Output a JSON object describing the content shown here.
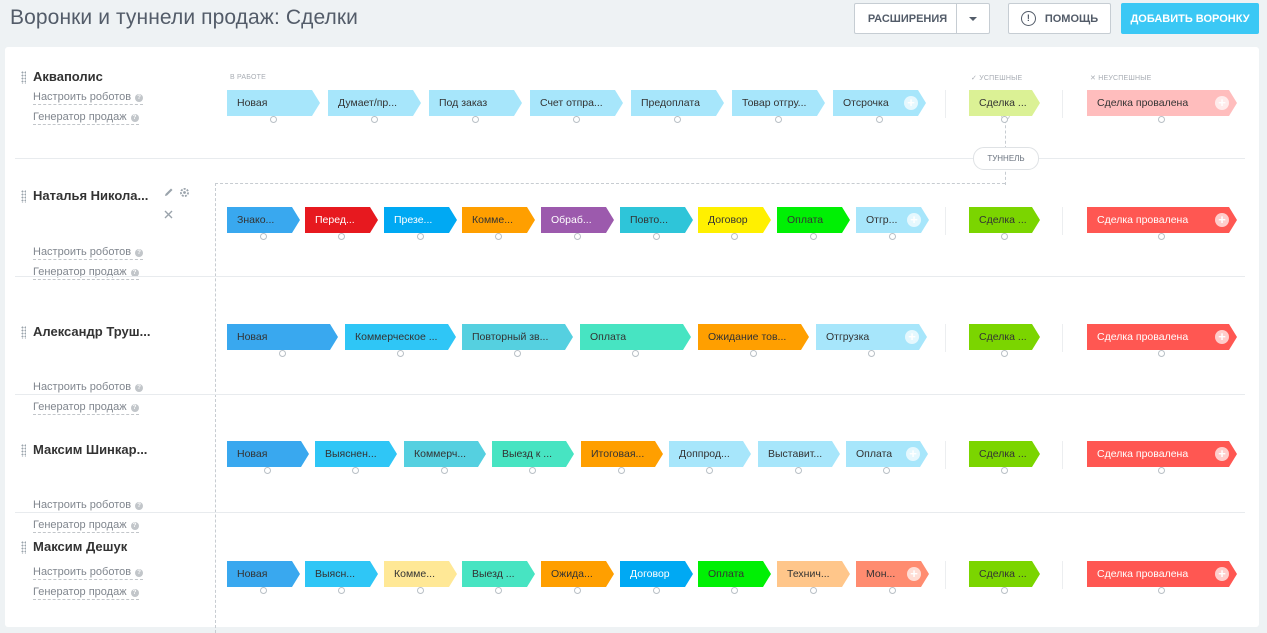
{
  "header": {
    "title": "Воронки и туннели продаж: Сделки",
    "extensions_label": "РАСШИРЕНИЯ",
    "help_label": "ПОМОЩЬ",
    "add_label": "ДОБАВИТЬ ВОРОНКУ"
  },
  "sections": {
    "in_work": "В РАБОТЕ",
    "success": "УСПЕШНЫЕ",
    "fail": "НЕУСПЕШНЫЕ"
  },
  "tunnel_label": "ТУННЕЛЬ",
  "funnels": [
    {
      "name": "Акваполис",
      "robots": "Настроить роботов",
      "generator": "Генератор продаж",
      "stages": [
        {
          "label": "Новая",
          "color": "#a7e6fb"
        },
        {
          "label": "Думает/пр...",
          "color": "#a7e6fb"
        },
        {
          "label": "Под заказ",
          "color": "#a7e6fb"
        },
        {
          "label": "Счет отпра...",
          "color": "#a7e6fb"
        },
        {
          "label": "Предоплата",
          "color": "#a7e6fb"
        },
        {
          "label": "Товар отгру...",
          "color": "#a7e6fb"
        },
        {
          "label": "Отсрочка",
          "color": "#a7e6fb"
        }
      ],
      "success": {
        "label": "Сделка ...",
        "color": "#dbf195"
      },
      "fail": {
        "label": "Сделка провалена",
        "color": "#ffbdbd"
      }
    },
    {
      "name": "Наталья Никола...",
      "robots": "Настроить роботов",
      "generator": "Генератор продаж",
      "stages": [
        {
          "label": "Знако...",
          "color": "#39a8ef"
        },
        {
          "label": "Перед...",
          "color": "#e7191f"
        },
        {
          "label": "Презе...",
          "color": "#00a9f3"
        },
        {
          "label": "Комме...",
          "color": "#ff9f00"
        },
        {
          "label": "Обраб...",
          "color": "#9c5aad"
        },
        {
          "label": "Повто...",
          "color": "#2ec5d9"
        },
        {
          "label": "Договор",
          "color": "#fff000"
        },
        {
          "label": "Оплата",
          "color": "#00f004"
        },
        {
          "label": "Отгр...",
          "color": "#a7e6fb"
        }
      ],
      "success": {
        "label": "Сделка ...",
        "color": "#7bd500"
      },
      "fail": {
        "label": "Сделка провалена",
        "color": "#ff5752"
      }
    },
    {
      "name": "Александр Труш...",
      "robots": "Настроить роботов",
      "generator": "Генератор продаж",
      "stages": [
        {
          "label": "Новая",
          "color": "#39a8ef"
        },
        {
          "label": "Коммерческое ...",
          "color": "#2fc6f6"
        },
        {
          "label": "Повторный зв...",
          "color": "#55d0e0"
        },
        {
          "label": "Оплата",
          "color": "#47e4c2"
        },
        {
          "label": "Ожидание тов...",
          "color": "#ff9f00"
        },
        {
          "label": "Отгрузка",
          "color": "#a7e6fb"
        }
      ],
      "success": {
        "label": "Сделка ...",
        "color": "#7bd500"
      },
      "fail": {
        "label": "Сделка провалена",
        "color": "#ff5752"
      }
    },
    {
      "name": "Максим Шинкар...",
      "robots": "Настроить роботов",
      "generator": "Генератор продаж",
      "stages": [
        {
          "label": "Новая",
          "color": "#39a8ef"
        },
        {
          "label": "Выяснен...",
          "color": "#2fc6f6"
        },
        {
          "label": "Коммерч...",
          "color": "#55d0e0"
        },
        {
          "label": "Выезд к ...",
          "color": "#47e4c2"
        },
        {
          "label": "Итоговая...",
          "color": "#ff9f00"
        },
        {
          "label": "Доппрод...",
          "color": "#a7e6fb"
        },
        {
          "label": "Выставит...",
          "color": "#a7e6fb"
        },
        {
          "label": "Оплата",
          "color": "#a7e6fb"
        }
      ],
      "success": {
        "label": "Сделка ...",
        "color": "#7bd500"
      },
      "fail": {
        "label": "Сделка провалена",
        "color": "#ff5752"
      }
    },
    {
      "name": "Максим Дешук",
      "robots": "Настроить роботов",
      "generator": "Генератор продаж",
      "stages": [
        {
          "label": "Новая",
          "color": "#39a8ef"
        },
        {
          "label": "Выясн...",
          "color": "#2fc6f6"
        },
        {
          "label": "Комме...",
          "color": "#ffe896"
        },
        {
          "label": "Выезд ...",
          "color": "#47e4c2"
        },
        {
          "label": "Ожида...",
          "color": "#ff9f00"
        },
        {
          "label": "Договор",
          "color": "#00a9f3"
        },
        {
          "label": "Оплата",
          "color": "#00f004"
        },
        {
          "label": "Технич...",
          "color": "#ffc68a"
        },
        {
          "label": "Мон...",
          "color": "#ff8c70"
        }
      ],
      "success": {
        "label": "Сделка ...",
        "color": "#7bd500"
      },
      "fail": {
        "label": "Сделка провалена",
        "color": "#ff5752"
      }
    }
  ]
}
